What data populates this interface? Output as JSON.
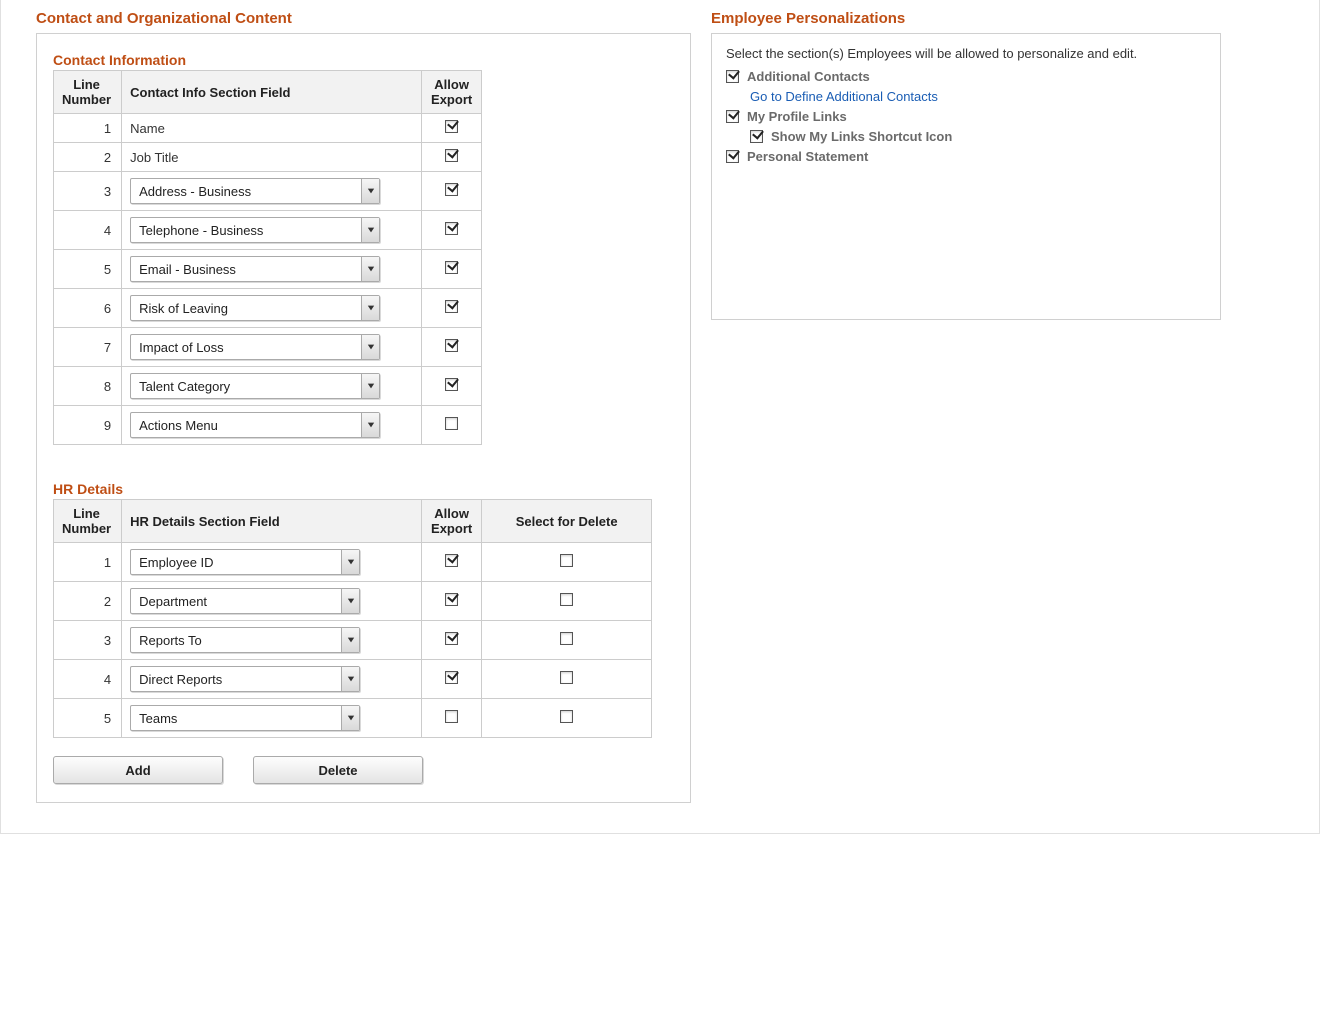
{
  "left": {
    "title": "Contact and Organizational Content",
    "contact": {
      "title": "Contact Information",
      "headers": {
        "line": "Line Number",
        "field": "Contact Info Section Field",
        "export": "Allow Export"
      },
      "rows": [
        {
          "num": "1",
          "value": "Name",
          "dropdown": false,
          "export": true
        },
        {
          "num": "2",
          "value": "Job Title",
          "dropdown": false,
          "export": true
        },
        {
          "num": "3",
          "value": "Address - Business",
          "dropdown": true,
          "export": true
        },
        {
          "num": "4",
          "value": "Telephone - Business",
          "dropdown": true,
          "export": true
        },
        {
          "num": "5",
          "value": "Email - Business",
          "dropdown": true,
          "export": true
        },
        {
          "num": "6",
          "value": "Risk of Leaving",
          "dropdown": true,
          "export": true
        },
        {
          "num": "7",
          "value": "Impact of Loss",
          "dropdown": true,
          "export": true
        },
        {
          "num": "8",
          "value": "Talent Category",
          "dropdown": true,
          "export": true
        },
        {
          "num": "9",
          "value": "Actions Menu",
          "dropdown": true,
          "export": false
        }
      ]
    },
    "hr": {
      "title": "HR Details",
      "headers": {
        "line": "Line Number",
        "field": "HR Details Section Field",
        "export": "Allow Export",
        "del": "Select for Delete"
      },
      "rows": [
        {
          "num": "1",
          "value": "Employee ID",
          "export": true,
          "del": false
        },
        {
          "num": "2",
          "value": "Department",
          "export": true,
          "del": false
        },
        {
          "num": "3",
          "value": "Reports To",
          "export": true,
          "del": false
        },
        {
          "num": "4",
          "value": "Direct Reports",
          "export": true,
          "del": false
        },
        {
          "num": "5",
          "value": "Teams",
          "export": false,
          "del": false
        }
      ],
      "buttons": {
        "add": "Add",
        "del": "Delete"
      }
    }
  },
  "right": {
    "title": "Employee Personalizations",
    "instruction": "Select the section(s) Employees will be allowed to personalize and edit.",
    "items": {
      "additional_contacts": {
        "label": "Additional Contacts",
        "checked": true,
        "link": "Go to Define Additional Contacts"
      },
      "my_profile_links": {
        "label": "My Profile Links",
        "checked": true,
        "sub": {
          "label": "Show My Links Shortcut Icon",
          "checked": true
        }
      },
      "personal_statement": {
        "label": "Personal Statement",
        "checked": true
      }
    }
  }
}
